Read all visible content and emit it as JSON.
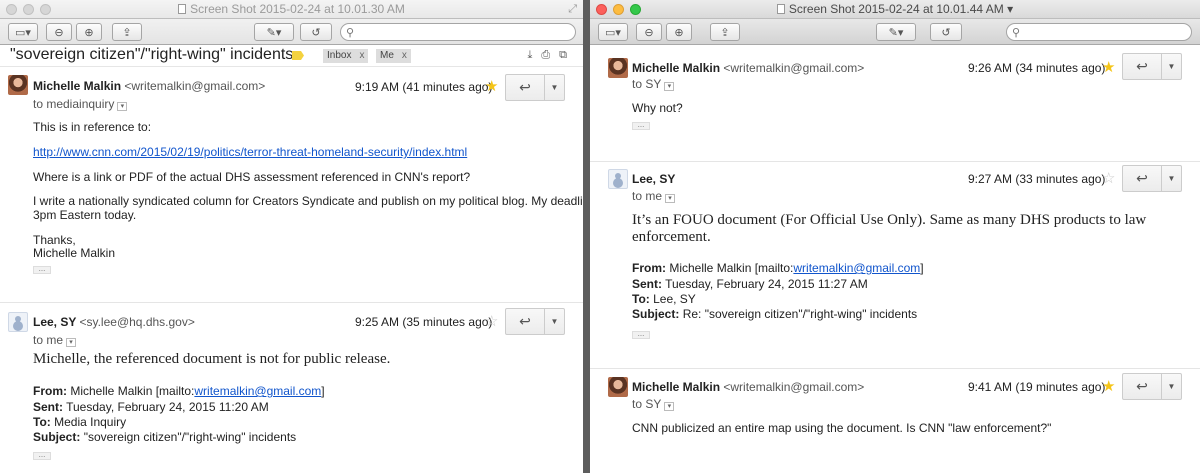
{
  "left_window": {
    "title": "Screen Shot 2015-02-24 at 10.01.30 AM",
    "subject": "\"sovereign citizen\"/\"right-wing\" incidents",
    "labels": [
      {
        "text": "Inbox",
        "close": "x"
      },
      {
        "text": "Me",
        "close": "x"
      }
    ],
    "messages": [
      {
        "sender_name": "Michelle Malkin",
        "sender_email": "<writemalkin@gmail.com>",
        "to": "to mediainquiry",
        "time": "9:19 AM (41 minutes ago)",
        "starred": true,
        "body": {
          "intro": "This is in reference to:",
          "link": "http://www.cnn.com/2015/02/19/politics/terror-threat-homeland-security/index.html",
          "question": "Where is a link or PDF of the actual DHS assessment referenced in CNN's report?",
          "para_line1": "I write a nationally syndicated column for Creators Syndicate and publish on my political blog. My deadline is",
          "para_line2": "3pm Eastern today.",
          "thanks": "Thanks,",
          "signature": "Michelle Malkin"
        }
      },
      {
        "sender_name": "Lee, SY",
        "sender_email": "<sy.lee@hq.dhs.gov>",
        "to": "to me",
        "time": "9:25 AM (35 minutes ago)",
        "starred": false,
        "body": {
          "main": "Michelle, the referenced document is not for public release.",
          "from_label": "From:",
          "from_value": "Michelle Malkin [mailto:",
          "from_link": "writemalkin@gmail.com",
          "from_close": "]",
          "sent_label": "Sent:",
          "sent_value": "Tuesday, February 24, 2015 11:20 AM",
          "to_label": "To:",
          "to_value": "Media Inquiry",
          "subject_label": "Subject:",
          "subject_value": "\"sovereign citizen\"/\"right-wing\" incidents"
        }
      }
    ]
  },
  "right_window": {
    "title": "Screen Shot 2015-02-24 at 10.01.44 AM",
    "messages": [
      {
        "sender_name": "Michelle Malkin",
        "sender_email": "<writemalkin@gmail.com>",
        "to": "to SY",
        "time": "9:26 AM (34 minutes ago)",
        "starred": true,
        "body": {
          "main": "Why not?"
        }
      },
      {
        "sender_name": "Lee, SY",
        "to": "to me",
        "time": "9:27 AM (33 minutes ago)",
        "starred": false,
        "body": {
          "main_line1": "It’s an FOUO document (For Official Use Only). Same as many DHS products to law",
          "main_line2": "enforcement.",
          "from_label": "From:",
          "from_value": "Michelle Malkin [mailto:",
          "from_link": "writemalkin@gmail.com",
          "from_close": "]",
          "sent_label": "Sent:",
          "sent_value": "Tuesday, February 24, 2015 11:27 AM",
          "to_label": "To:",
          "to_value": "Lee, SY",
          "subject_label": "Subject:",
          "subject_value": "Re: \"sovereign citizen\"/\"right-wing\" incidents"
        }
      },
      {
        "sender_name": "Michelle Malkin",
        "sender_email": "<writemalkin@gmail.com>",
        "to": "to SY",
        "time": "9:41 AM (19 minutes ago)",
        "starred": true,
        "body": {
          "main": "CNN publicized an entire map using the document. Is CNN \"law enforcement?\""
        }
      }
    ]
  },
  "colors": {
    "star_on": "#f5c518",
    "link": "#1155cc",
    "divider": "#5d5d5d"
  },
  "icons": [
    "sidebar-icon",
    "zoom-out-icon",
    "zoom-in-icon",
    "share-icon",
    "annotate-icon",
    "rotate-icon",
    "search-icon",
    "reply-icon",
    "star-icon",
    "print-icon",
    "archive-icon",
    "new-window-icon"
  ]
}
